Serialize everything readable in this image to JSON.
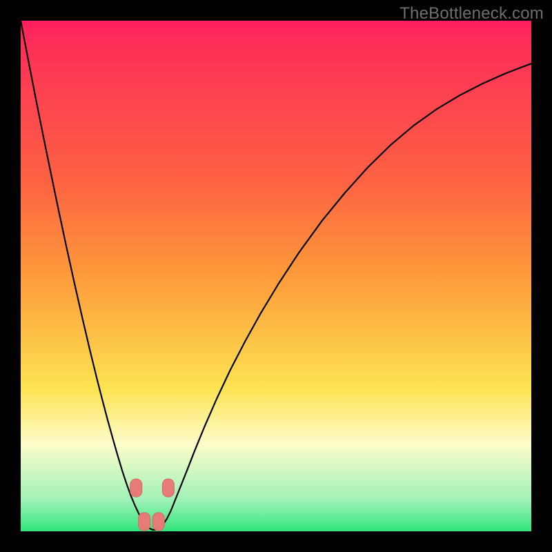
{
  "watermark": "TheBottleneck.com",
  "colors": {
    "black": "#000000",
    "curve": "#000000",
    "marker_fill": "#e77c76",
    "marker_stroke": "#d66a64",
    "green": "#2fe57a",
    "green_light": "#9ff2b8",
    "yellow_pale": "#fdfccb",
    "yellow": "#fde352",
    "orange": "#fd9b3a",
    "orange_red": "#fd6143",
    "red": "#fd2e58",
    "magenta": "#fd1d60"
  },
  "chart_data": {
    "type": "line",
    "title": "",
    "xlabel": "",
    "ylabel": "",
    "xlim": [
      0,
      1
    ],
    "ylim": [
      0,
      1
    ],
    "x": [
      0.0,
      0.015,
      0.03,
      0.045,
      0.06,
      0.075,
      0.09,
      0.105,
      0.12,
      0.135,
      0.15,
      0.16,
      0.17,
      0.18,
      0.19,
      0.2,
      0.208,
      0.216,
      0.224,
      0.232,
      0.24,
      0.246,
      0.252,
      0.258,
      0.264,
      0.27,
      0.278,
      0.286,
      0.294,
      0.302,
      0.312,
      0.326,
      0.34,
      0.36,
      0.385,
      0.41,
      0.44,
      0.47,
      0.505,
      0.545,
      0.59,
      0.635,
      0.68,
      0.725,
      0.77,
      0.815,
      0.86,
      0.905,
      0.95,
      1.0
    ],
    "values": [
      1.0,
      0.922,
      0.845,
      0.77,
      0.697,
      0.625,
      0.555,
      0.487,
      0.421,
      0.357,
      0.296,
      0.257,
      0.219,
      0.183,
      0.148,
      0.115,
      0.091,
      0.069,
      0.05,
      0.033,
      0.019,
      0.011,
      0.006,
      0.003,
      0.003,
      0.005,
      0.012,
      0.024,
      0.04,
      0.06,
      0.085,
      0.12,
      0.156,
      0.205,
      0.262,
      0.315,
      0.373,
      0.427,
      0.485,
      0.546,
      0.608,
      0.663,
      0.713,
      0.757,
      0.795,
      0.827,
      0.854,
      0.877,
      0.897,
      0.916
    ],
    "minimum_x": 0.26,
    "markers_x": [
      0.226,
      0.242,
      0.27,
      0.289
    ],
    "markers_y": [
      0.085,
      0.019,
      0.019,
      0.085
    ],
    "gradient_stops": [
      {
        "pos": 0.0,
        "key": "magenta"
      },
      {
        "pos": 0.04,
        "key": "red"
      },
      {
        "pos": 0.31,
        "key": "orange_red"
      },
      {
        "pos": 0.5,
        "key": "orange"
      },
      {
        "pos": 0.72,
        "key": "yellow"
      },
      {
        "pos": 0.83,
        "key": "yellow_pale"
      },
      {
        "pos": 0.94,
        "key": "green_light"
      },
      {
        "pos": 1.0,
        "key": "green"
      }
    ]
  }
}
